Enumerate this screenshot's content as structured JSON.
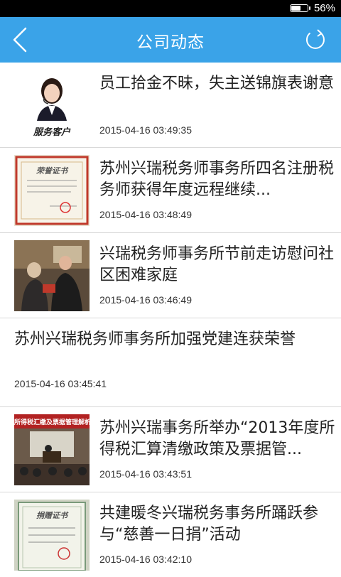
{
  "status_bar": {
    "battery_text": "56%",
    "battery_level": 0.56
  },
  "nav": {
    "title": "公司动态"
  },
  "items": [
    {
      "title": "员工拾金不昧，失主送锦旗表谢意",
      "time": "2015-04-16 03:49:35",
      "thumb": "service-avatar",
      "thumb_caption": "服务客户"
    },
    {
      "title": "苏州兴瑞税务师事务所四名注册税务师获得年度远程继续...",
      "time": "2015-04-16 03:48:49",
      "thumb": "certificate",
      "thumb_caption": "荣誉证书"
    },
    {
      "title": "兴瑞税务师事务所节前走访慰问社区困难家庭",
      "time": "2015-04-16 03:46:49",
      "thumb": "visit-photo"
    },
    {
      "title": "苏州兴瑞税务师事务所加强党建连获荣誉",
      "time": "2015-04-16 03:45:41"
    },
    {
      "title": "苏州兴瑞事务所举办“2013年度所得税汇算清缴政策及票据管...",
      "time": "2015-04-16 03:43:51",
      "thumb": "meeting-photo",
      "thumb_caption": "所得税汇缴及票据管理解析"
    },
    {
      "title": "共建暖冬兴瑞税务事务所踊跃参与“慈善一日捐”活动",
      "time": "2015-04-16 03:42:10",
      "thumb": "certificate-green",
      "thumb_caption": "捐赠证书"
    }
  ]
}
